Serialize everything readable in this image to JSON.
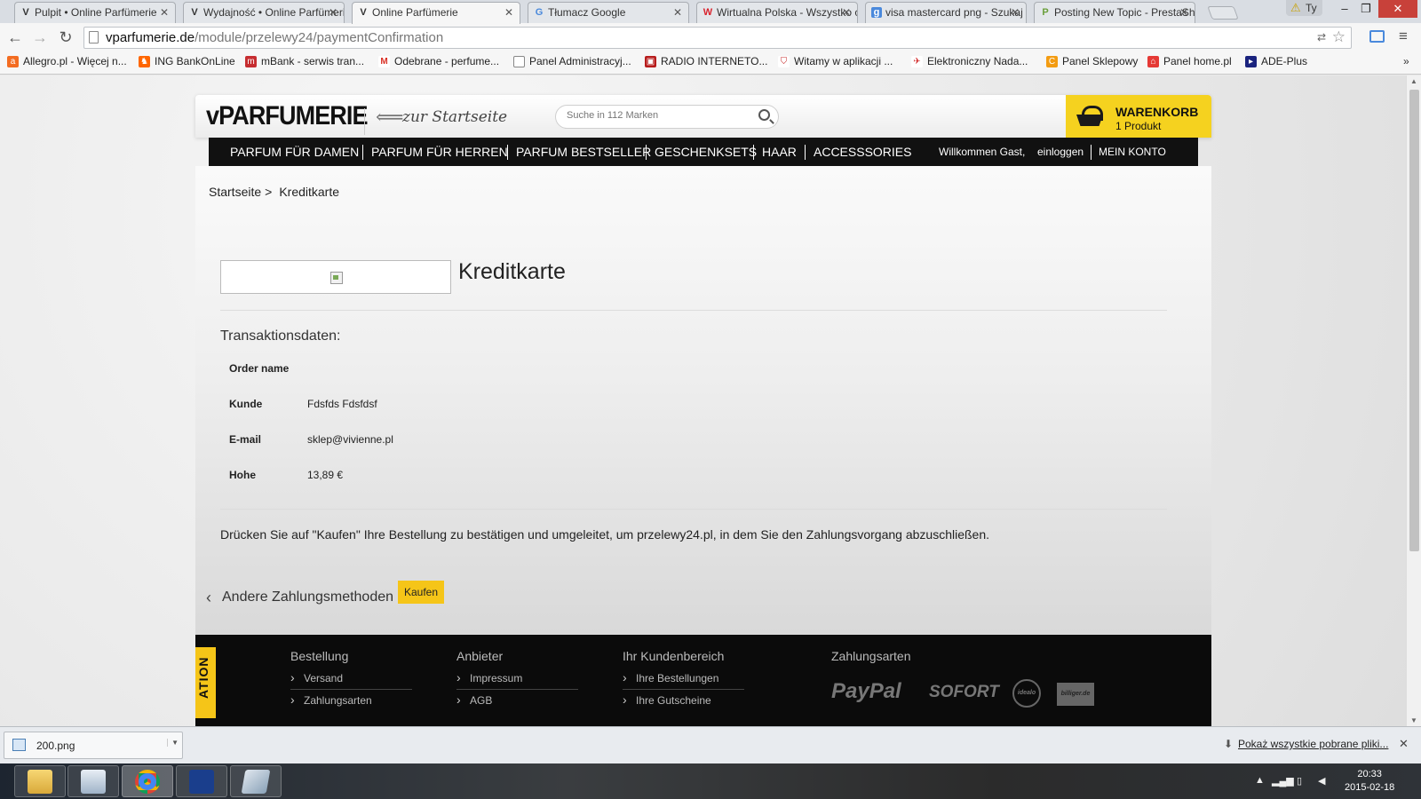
{
  "browser": {
    "tabs": [
      {
        "label": "Pulpit • Online Parfümerie",
        "favicon": "V",
        "active": false
      },
      {
        "label": "Wydajność • Online Parfümerie",
        "favicon": "V",
        "active": false
      },
      {
        "label": "Online Parfümerie",
        "favicon": "V",
        "active": true
      },
      {
        "label": "Tłumacz Google",
        "favicon": "G",
        "active": false
      },
      {
        "label": "Wirtualna Polska - Wszystko co ważne",
        "favicon": "W",
        "active": false
      },
      {
        "label": "visa mastercard png - Szukaj w Google",
        "favicon": "g",
        "active": false
      },
      {
        "label": "Posting New Topic - PrestaShop",
        "favicon": "P",
        "active": false
      }
    ],
    "user_badge": "Ty",
    "url_host": "vparfumerie.de",
    "url_path": "/module/przelewy24/paymentConfirmation",
    "bookmarks": [
      "Allegro.pl - Więcej n...",
      "ING BankOnLine",
      "mBank - serwis tran...",
      "Odebrane - perfume...",
      "Panel Administracyj...",
      "RADIO INTERNETO...",
      "Witamy w aplikacji ...",
      "Elektroniczny Nada...",
      "Panel Sklepowy",
      "Panel home.pl",
      "ADE-Plus"
    ],
    "bookmarks_more": "»"
  },
  "site": {
    "logo": "vPARFUMERIE",
    "home_link": "zur Startseite",
    "search_placeholder": "Suche in 112 Marken",
    "cart_title": "WARENKORB",
    "cart_count": "1 Produkt",
    "nav": [
      "PARFUM FÜR DAMEN",
      "PARFUM FÜR HERREN",
      "PARFUM BESTSELLER",
      "GESCHENKSETS",
      "HAAR",
      "ACCESSSORIES"
    ],
    "welcome": "Willkommen Gast,",
    "login": "einloggen",
    "account": "MEIN KONTO"
  },
  "breadcrumb": {
    "home": "Startseite",
    "sep": ">",
    "current": "Kreditkarte"
  },
  "payment": {
    "title": "Kreditkarte",
    "section_title": "Transaktionsdaten:",
    "rows": [
      {
        "label": "Order name",
        "value": ""
      },
      {
        "label": "Kunde",
        "value": "Fdsfds Fdsfdsf"
      },
      {
        "label": "E-mail",
        "value": "sklep@vivienne.pl"
      },
      {
        "label": "Hohe",
        "value": "13,89 €"
      }
    ],
    "info": "Drücken Sie auf \"Kaufen\" Ihre Bestellung zu bestätigen und umgeleitet, um przelewy24.pl, in dem Sie den Zahlungsvorgang abzuschließen.",
    "back_link": "Andere Zahlungsmethoden",
    "buy_button": "Kaufen"
  },
  "footer": {
    "side_tab": "ATION",
    "columns": [
      {
        "heading": "Bestellung",
        "links": [
          "Versand",
          "Zahlungsarten"
        ]
      },
      {
        "heading": "Anbieter",
        "links": [
          "Impressum",
          "AGB"
        ]
      },
      {
        "heading": "Ihr Kundenbereich",
        "links": [
          "Ihre Bestellungen",
          "Ihre Gutscheine"
        ]
      }
    ],
    "payments_heading": "Zahlungsarten",
    "payment_logos": [
      "PayPal",
      "SOFORT",
      "idealo",
      "billiger.de"
    ]
  },
  "downloads": {
    "file": "200.png",
    "show_all": "Pokaż wszystkie pobrane pliki..."
  },
  "taskbar": {
    "time": "20:33",
    "date": "2015-02-18"
  },
  "colors": {
    "accent": "#f5c518",
    "nav_bg": "#111111",
    "footer_bg": "#0b0b0b"
  }
}
